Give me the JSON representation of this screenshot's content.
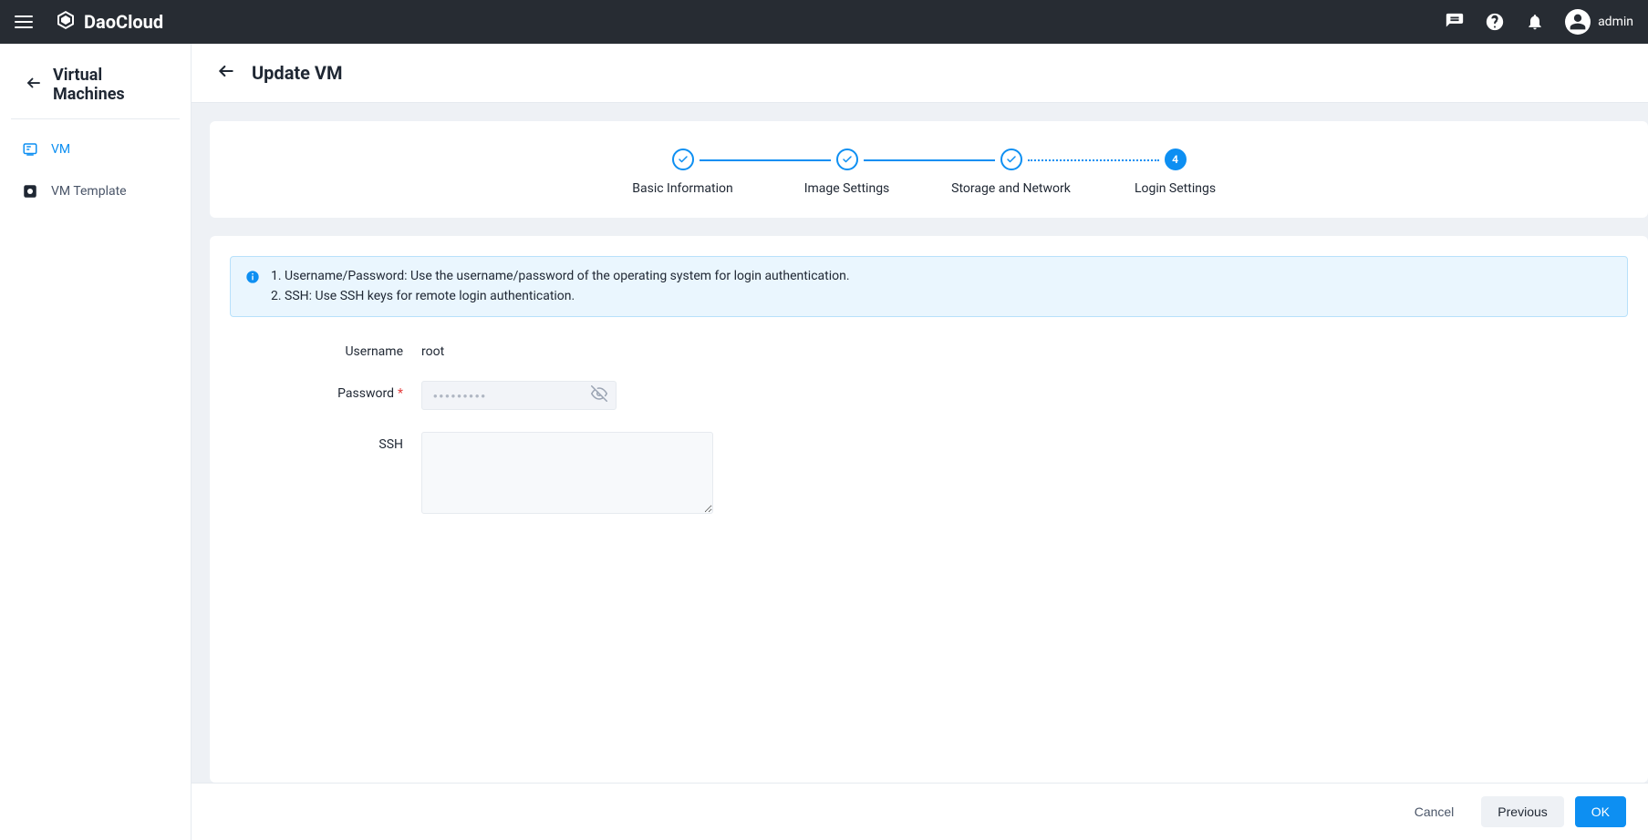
{
  "topbar": {
    "brand": "DaoCloud",
    "user_name": "admin"
  },
  "sidebar": {
    "title": "Virtual Machines",
    "items": [
      {
        "label": "VM",
        "active": true
      },
      {
        "label": "VM Template",
        "active": false
      }
    ]
  },
  "page": {
    "title": "Update VM"
  },
  "stepper": {
    "steps": [
      {
        "label": "Basic Information",
        "state": "done"
      },
      {
        "label": "Image Settings",
        "state": "done"
      },
      {
        "label": "Storage and Network",
        "state": "done"
      },
      {
        "label": "Login Settings",
        "state": "current",
        "number": "4"
      }
    ]
  },
  "info": {
    "line1": "1. Username/Password: Use the username/password of the operating system for login authentication.",
    "line2": "2. SSH: Use SSH keys for remote login authentication."
  },
  "form": {
    "username_label": "Username",
    "username_value": "root",
    "password_label": "Password",
    "password_placeholder": "•••••••••",
    "password_value": "",
    "ssh_label": "SSH",
    "ssh_value": ""
  },
  "footer": {
    "cancel": "Cancel",
    "previous": "Previous",
    "ok": "OK"
  }
}
